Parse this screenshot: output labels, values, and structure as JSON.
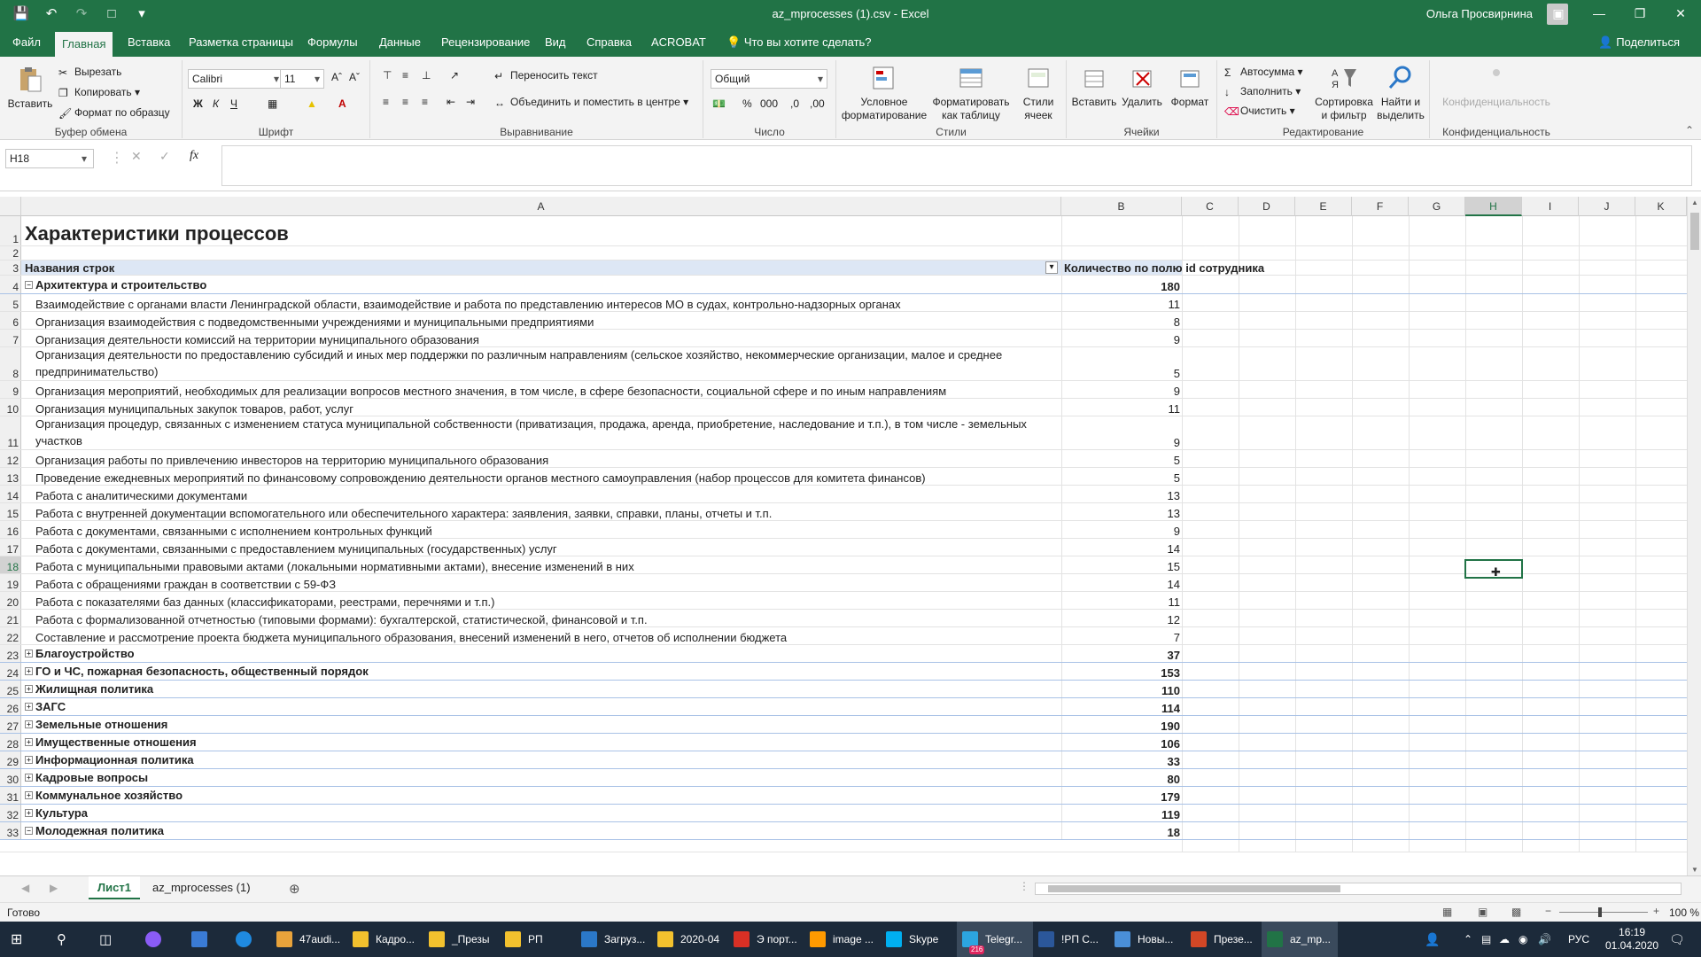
{
  "window": {
    "title": "az_mprocesses (1).csv  -  Excel",
    "user": "Ольга Просвирнина"
  },
  "menu": {
    "tabs": [
      "Файл",
      "Главная",
      "Вставка",
      "Разметка страницы",
      "Формулы",
      "Данные",
      "Рецензирование",
      "Вид",
      "Справка",
      "ACROBAT"
    ],
    "tell_me": "Что вы хотите сделать?",
    "share": "Поделиться"
  },
  "ribbon": {
    "clipboard": {
      "paste": "Вставить",
      "cut": "Вырезать",
      "copy": "Копировать",
      "format_painter": "Формат по образцу",
      "label": "Буфер обмена"
    },
    "font": {
      "name": "Calibri",
      "size": "11",
      "bold": "Ж",
      "italic": "К",
      "underline": "Ч",
      "label": "Шрифт"
    },
    "alignment": {
      "wrap": "Переносить текст",
      "merge": "Объединить и поместить в центре",
      "label": "Выравнивание"
    },
    "number": {
      "format": "Общий",
      "label": "Число"
    },
    "styles": {
      "conditional_1": "Условное",
      "conditional_2": "форматирование",
      "table_1": "Форматировать",
      "table_2": "как таблицу",
      "cell_styles_1": "Стили",
      "cell_styles_2": "ячеек",
      "label": "Стили"
    },
    "cells": {
      "insert": "Вставить",
      "delete": "Удалить",
      "format": "Формат",
      "label": "Ячейки"
    },
    "editing": {
      "autosum": "Автосумма",
      "fill": "Заполнить",
      "clear": "Очистить",
      "sort_1": "Сортировка",
      "sort_2": "и фильтр",
      "find_1": "Найти и",
      "find_2": "выделить",
      "label": "Редактирование"
    },
    "privacy": {
      "button": "Конфиденциальность",
      "label": "Конфиденциальность"
    }
  },
  "formula_bar": {
    "name_box": "H18",
    "fx": "fx",
    "value": ""
  },
  "columns": [
    "A",
    "B",
    "C",
    "D",
    "E",
    "F",
    "G",
    "H",
    "I",
    "J",
    "K"
  ],
  "sheet": {
    "title": "Характеристики процессов",
    "header_a": "Названия строк",
    "header_b": "Количество по полю id сотрудника",
    "rows": [
      {
        "n": "4",
        "a": "Архитектура и строительство",
        "b": "180",
        "bold": true,
        "toggle": "−"
      },
      {
        "n": "5",
        "a": "Взаимодействие с органами власти Ленинградской области, взаимодействие и работа по представлению интересов МО в судах, контрольно-надзорных органах",
        "b": "11"
      },
      {
        "n": "6",
        "a": "Организация взаимодействия с подведомственными учреждениями и муниципальными предприятиями",
        "b": "8"
      },
      {
        "n": "7",
        "a": "Организация деятельности комиссий на территории муниципального образования",
        "b": "9"
      },
      {
        "n": "8",
        "a": "Организация деятельности по предоставлению субсидий и иных мер поддержки по различным направлениям (сельское хозяйство, некоммерческие организации, малое и среднее предпринимательство)",
        "b": "5",
        "tall": true
      },
      {
        "n": "9",
        "a": "Организация мероприятий, необходимых для реализации вопросов местного значения, в том числе, в сфере безопасности, социальной сфере и по иным направлениям",
        "b": "9"
      },
      {
        "n": "10",
        "a": "Организация муниципальных закупок товаров, работ, услуг",
        "b": "11"
      },
      {
        "n": "11",
        "a": "Организация процедур, связанных с изменением статуса муниципальной собственности (приватизация, продажа, аренда, приобретение, наследование и т.п.), в том числе - земельных участков",
        "b": "9",
        "tall": true
      },
      {
        "n": "12",
        "a": "Организация работы по привлечению инвесторов на территорию муниципального образования",
        "b": "5"
      },
      {
        "n": "13",
        "a": "Проведение ежедневных мероприятий по финансовому сопровождению деятельности органов местного самоуправления (набор процессов для комитета финансов)",
        "b": "5"
      },
      {
        "n": "14",
        "a": "Работа с аналитическими документами",
        "b": "13"
      },
      {
        "n": "15",
        "a": "Работа с внутренней документации вспомогательного или обеспечительного характера: заявления, заявки, справки, планы, отчеты и т.п.",
        "b": "13"
      },
      {
        "n": "16",
        "a": "Работа с документами, связанными с исполнением контрольных функций",
        "b": "9"
      },
      {
        "n": "17",
        "a": "Работа с документами, связанными с предоставлением муниципальных (государственных) услуг",
        "b": "14"
      },
      {
        "n": "18",
        "a": "Работа с муниципальными правовыми актами (локальными нормативными актами), внесение изменений в них",
        "b": "15"
      },
      {
        "n": "19",
        "a": "Работа с обращениями граждан в соответствии с 59-ФЗ",
        "b": "14"
      },
      {
        "n": "20",
        "a": "Работа с показателями баз данных (классификаторами, реестрами, перечнями и т.п.)",
        "b": "11"
      },
      {
        "n": "21",
        "a": "Работа с формализованной отчетностью (типовыми формами): бухгалтерской, статистической, финансовой и т.п.",
        "b": "12"
      },
      {
        "n": "22",
        "a": "Составление и рассмотрение проекта бюджета муниципального образования, внесений изменений в него, отчетов об исполнении бюджета",
        "b": "7"
      },
      {
        "n": "23",
        "a": "Благоустройство",
        "b": "37",
        "bold": true,
        "toggle": "+"
      },
      {
        "n": "24",
        "a": "ГО и ЧС, пожарная безопасность, общественный порядок",
        "b": "153",
        "bold": true,
        "toggle": "+"
      },
      {
        "n": "25",
        "a": "Жилищная политика",
        "b": "110",
        "bold": true,
        "toggle": "+"
      },
      {
        "n": "26",
        "a": "ЗАГС",
        "b": "114",
        "bold": true,
        "toggle": "+"
      },
      {
        "n": "27",
        "a": "Земельные отношения",
        "b": "190",
        "bold": true,
        "toggle": "+"
      },
      {
        "n": "28",
        "a": "Имущественные отношения",
        "b": "106",
        "bold": true,
        "toggle": "+"
      },
      {
        "n": "29",
        "a": "Информационная политика",
        "b": "33",
        "bold": true,
        "toggle": "+"
      },
      {
        "n": "30",
        "a": "Кадровые вопросы",
        "b": "80",
        "bold": true,
        "toggle": "+"
      },
      {
        "n": "31",
        "a": "Коммунальное хозяйство",
        "b": "179",
        "bold": true,
        "toggle": "+"
      },
      {
        "n": "32",
        "a": "Культура",
        "b": "119",
        "bold": true,
        "toggle": "+"
      },
      {
        "n": "33",
        "a": "Молодежная политика",
        "b": "18",
        "bold": true,
        "toggle": "−"
      }
    ]
  },
  "sheet_tabs": [
    "Лист1",
    "az_mprocesses (1)"
  ],
  "status": {
    "ready": "Готово",
    "zoom": "100 %"
  },
  "taskbar": {
    "items": [
      "47audi...",
      "Кадро...",
      "_Презы",
      "РП",
      "Загруз...",
      "2020-04",
      "Э порт...",
      "image ...",
      "Skype",
      "Telegr...",
      "!РП С...",
      "Новы...",
      "Презе...",
      "az_mp..."
    ],
    "lang": "РУС",
    "time": "16:19",
    "date": "01.04.2020",
    "telegram_badge": "216"
  },
  "colors": {
    "accent": "#217346",
    "pivot_header": "#dde7f5"
  }
}
